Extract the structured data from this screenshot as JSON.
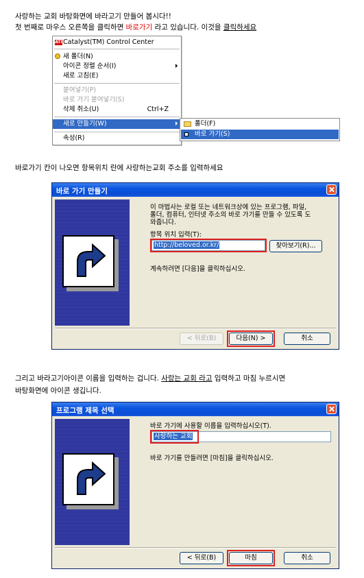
{
  "intro": {
    "line1": "사랑하는 교회 바탕화면에 바라고기 만들어 봅시다!!",
    "line2_a": "첫 번째로 마우스 오른쪽을 클릭하면 ",
    "line2_red": "바로가기",
    "line2_b": " 라고 있습니다. 이것을 ",
    "line2_ul": "클릭하세요"
  },
  "context_menu": {
    "header": "Catalyst(TM) Control Center",
    "items": [
      {
        "label": "새 폴더(N)"
      },
      {
        "label": "아이콘 정렬 순서(I)"
      },
      {
        "label": "새로 고침(E)"
      },
      {
        "label": "붙여넣기(P)"
      },
      {
        "label": "바로 가기 붙여넣기(S)"
      },
      {
        "label": "삭제 취소(U)",
        "shortcut": "Ctrl+Z"
      },
      {
        "label": "새로 만들기(W)"
      },
      {
        "label": "속성(R)"
      }
    ],
    "submenu": [
      {
        "label": "폴더(F)"
      },
      {
        "label": "바로 가기(S)"
      }
    ]
  },
  "step2_text": "바로가기 칸이 나오면  항목위치 란에 사랑하는교회 주소를 입력하세요",
  "dialog1": {
    "title": "바로 가기 만들기",
    "description": "이 마법사는 로컬 또는 네트워크상에 있는 프로그램, 파일, 폴더, 컴퓨터, 인터넷 주소의 바로 가기를 만들 수 있도록 도와줍니다.",
    "desc_line1": "이 마법사는 로컬 또는 네트워크상에 있는 프로그램, 파일,",
    "desc_line2": "폴더, 컴퓨터, 인터넷 주소의 바로 가기를 만들 수 있도록 도",
    "desc_line3": "와줍니다.",
    "location_label": "항목 위치 입력(T):",
    "location_value": "http://beloved.or.kr/",
    "browse_button": "찾아보기(R)...",
    "continue_text": "계속하려면 [다음]을 클릭하십시오.",
    "back_button": "< 뒤로(B)",
    "next_button": "다음(N) >",
    "cancel_button": "취소"
  },
  "step3_text": {
    "line1_a": "그리고 바라고기아이콘 이름을 입력하는 겁니다. ",
    "line1_ul": "사랑는 교회 라고",
    "line1_b": " 입력하고 마침 누르시면",
    "line2": "바탕화면에 아이콘 생깁니다."
  },
  "dialog2": {
    "title": "프로그램 제목 선택",
    "name_label": "바로 가기에 사용할 이름을 입력하십시오(T).",
    "name_value": "사랑하는 교회",
    "finish_text": "바로 가기를 만들려면 [마침]을 클릭하십시오.",
    "back_button": "< 뒤로(B)",
    "finish_button": "마침",
    "cancel_button": "취소"
  },
  "colors": {
    "highlight": "#316ac5",
    "annotation_red": "#e02020",
    "titlebar_blue": "#0a4ed4",
    "wizard_side": "#232b99",
    "dialog_bg": "#ece9d8"
  }
}
